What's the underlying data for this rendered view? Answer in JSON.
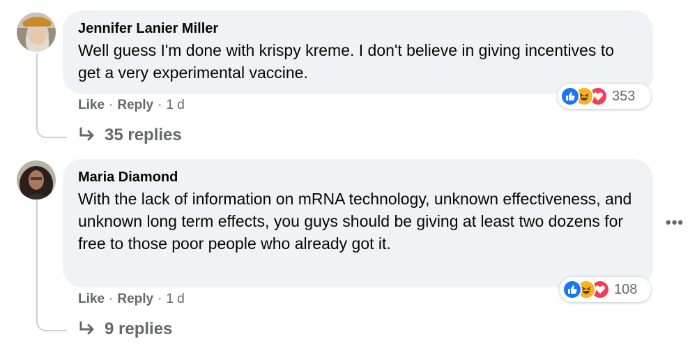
{
  "comments": [
    {
      "author": "Jennifer Lanier Miller",
      "text": "Well guess I'm done with krispy kreme. I don't believe in giving incentives to get a very experimental vaccine.",
      "reaction_count": "353",
      "like_label": "Like",
      "reply_label": "Reply",
      "separator": "·",
      "time": "1 d",
      "replies_label": "35 replies"
    },
    {
      "author": "Maria Diamond",
      "text": "With the lack of information on mRNA technology, unknown effectiveness, and unknown long term effects, you guys should be giving at least two dozens for free to those poor people who already got it.",
      "reaction_count": "108",
      "like_label": "Like",
      "reply_label": "Reply",
      "separator": "·",
      "time": "1 d",
      "replies_label": "9 replies"
    }
  ],
  "more_options": "•••",
  "colors": {
    "bubble_bg": "#f0f2f5",
    "meta_text": "#65676b",
    "like_blue": "#1877f2",
    "haha_yellow": "#f7b125",
    "love_red": "#f33e58"
  }
}
